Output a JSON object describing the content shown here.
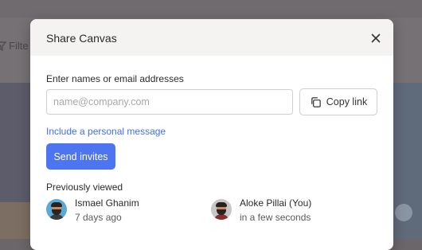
{
  "background": {
    "filter_label": "Filte"
  },
  "dialog": {
    "title": "Share Canvas",
    "field_label": "Enter names or email addresses",
    "email_placeholder": "name@company.com",
    "copy_link_label": "Copy link",
    "personal_message_link": "Include a personal message",
    "send_button_label": "Send invites",
    "previously_viewed_label": "Previously viewed",
    "viewers": [
      {
        "name": "Ismael Ghanim",
        "time": "7 days ago"
      },
      {
        "name": "Aloke Pillai (You)",
        "time": "in a few seconds"
      }
    ]
  },
  "colors": {
    "accent": "#4d74f1",
    "link": "#3d6ff0",
    "overlay": "#757174"
  }
}
